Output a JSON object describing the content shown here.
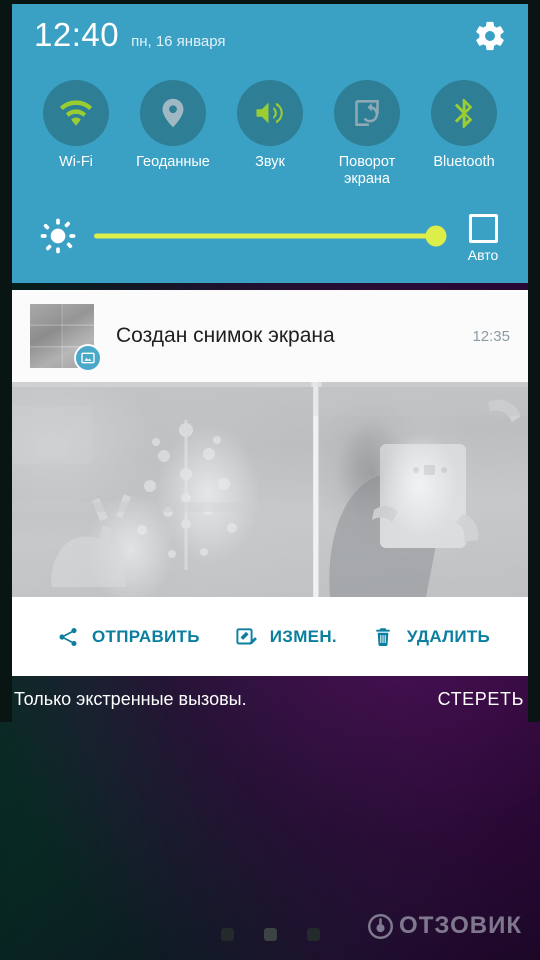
{
  "statusbar": {
    "clock": "12:40",
    "date": "пн, 16 января",
    "settings_icon": "gear-icon"
  },
  "quick_settings": {
    "panel_color": "#3aa0c4",
    "toggle_circle_color": "#2e7e96",
    "active_color": "#9acd32",
    "inactive_color": "#8fa9b5",
    "toggles": [
      {
        "id": "wifi",
        "label": "Wi-Fi",
        "icon": "wifi-icon",
        "active": true
      },
      {
        "id": "location",
        "label": "Геоданные",
        "icon": "location-pin-icon",
        "active": false
      },
      {
        "id": "sound",
        "label": "Звук",
        "icon": "volume-speaker-icon",
        "active": true
      },
      {
        "id": "rotation",
        "label": "Поворот\nэкрана",
        "icon": "screen-rotation-icon",
        "active": false
      },
      {
        "id": "bluetooth",
        "label": "Bluetooth",
        "icon": "bluetooth-icon",
        "active": true
      }
    ],
    "brightness": {
      "icon": "brightness-sun-icon",
      "value_percent": 100,
      "slider_color": "#ddee4a",
      "auto_label": "Авто",
      "auto_checked": false
    }
  },
  "notification": {
    "app_icon": "screenshot-image-icon",
    "title": "Создан снимок экрана",
    "time": "12:35",
    "preview_alt": "screenshot-preview-image",
    "actions": [
      {
        "id": "share",
        "label": "ОТПРАВИТЬ",
        "icon": "share-icon"
      },
      {
        "id": "edit",
        "label": "ИЗМЕН.",
        "icon": "edit-icon"
      },
      {
        "id": "delete",
        "label": "УДАЛИТЬ",
        "icon": "trash-icon"
      }
    ],
    "action_color": "#0b7fa0"
  },
  "bottom_bar": {
    "carrier_status": "Только экстренные вызовы.",
    "clear_all_label": "СТЕРЕТЬ"
  },
  "homescreen": {
    "page_dots": {
      "count": 3,
      "active_index": 1
    }
  },
  "watermark": {
    "text": "ОТЗОВИК",
    "logo": "otzovik-circle-logo"
  }
}
